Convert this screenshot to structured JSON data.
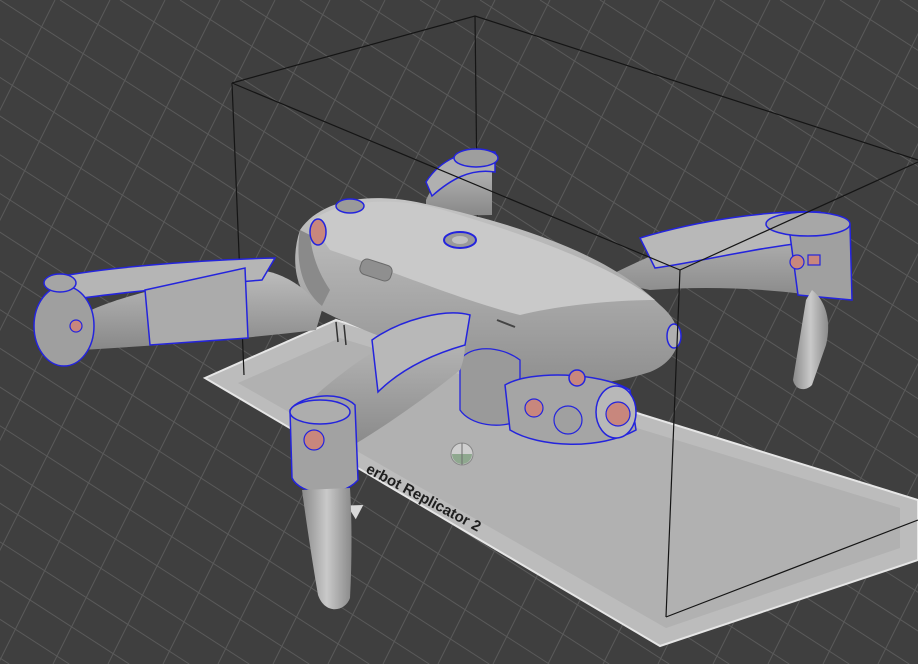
{
  "viewport": {
    "printer_label": "erbot Replicator 2",
    "background_color": "#3f3f3f",
    "grid_color": "#5a5a5a",
    "plate_color": "#bdbdbd",
    "model_color": "#a9a9a9",
    "edge_highlight_color": "#1f1fe0",
    "overhang_color": "#c8877d",
    "bounding_box_color": "#151515"
  },
  "objects": {
    "model": "drone-model",
    "origin_marker": "origin-gizmo-icon"
  }
}
